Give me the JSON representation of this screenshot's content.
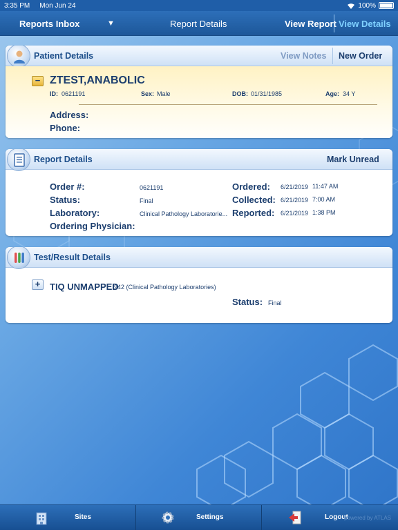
{
  "statusbar": {
    "time": "3:35 PM",
    "date": "Mon Jun 24",
    "battery": "100%"
  },
  "nav": {
    "inbox": "Reports Inbox",
    "title": "Report Details",
    "view_report": "View Report",
    "view_details": "View Details"
  },
  "patient": {
    "header": "Patient Details",
    "view_notes": "View Notes",
    "new_order": "New Order",
    "name": "ZTEST,ANABOLIC",
    "id_label": "ID:",
    "id": "0621191",
    "sex_label": "Sex:",
    "sex": "Male",
    "dob_label": "DOB:",
    "dob": "01/31/1985",
    "age_label": "Age:",
    "age": "34 Y",
    "address_label": "Address:",
    "phone_label": "Phone:"
  },
  "report": {
    "header": "Report Details",
    "mark_unread": "Mark Unread",
    "order_label": "Order #:",
    "order": "0621191",
    "status_label": "Status:",
    "status": "Final",
    "lab_label": "Laboratory:",
    "lab": "Clinical Pathology Laboratorie...",
    "physician_label": "Ordering Physician:",
    "ordered_label": "Ordered:",
    "ordered_date": "6/21/2019",
    "ordered_time": "11:47 AM",
    "collected_label": "Collected:",
    "collected_date": "6/21/2019",
    "collected_time": "7:00 AM",
    "reported_label": "Reported:",
    "reported_date": "6/21/2019",
    "reported_time": "1:38 PM"
  },
  "tests": {
    "header": "Test/Result Details",
    "name": "TIQ UNMAPPED",
    "detail": "942 (Clinical Pathology Laboratories)",
    "status_label": "Status:",
    "status": "Final"
  },
  "tabs": {
    "sites": "Sites",
    "settings": "Settings",
    "logout": "Logout",
    "brand": "powered by ATLAS"
  },
  "colors": {
    "navbar": "#1d5799",
    "accent": "#7fd0ff",
    "patient_highlight": "#fff2c4"
  }
}
